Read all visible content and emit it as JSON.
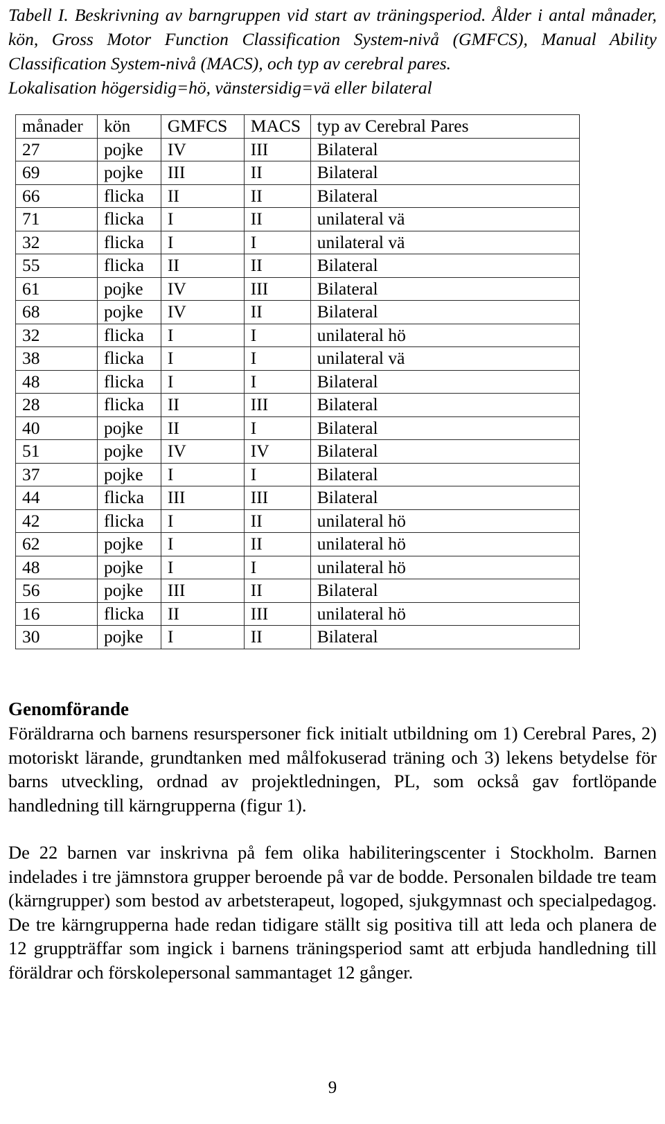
{
  "caption": {
    "lines": [
      "Tabell I. Beskrivning av barngruppen vid start av träningsperiod. Ålder i antal månader, kön, Gross Motor Function Classification System-nivå (GMFCS), Manual Ability Classification System-nivå (MACS), och typ av cerebral pares.",
      "Lokalisation högersidig=hö, vänstersidig=vä eller bilateral"
    ]
  },
  "table": {
    "headers": [
      "månader",
      "kön",
      "GMFCS",
      "MACS",
      "typ av Cerebral Pares"
    ],
    "rows": [
      [
        "27",
        "pojke",
        "IV",
        "III",
        "Bilateral"
      ],
      [
        "69",
        "pojke",
        "III",
        "II",
        "Bilateral"
      ],
      [
        "66",
        "flicka",
        "II",
        "II",
        "Bilateral"
      ],
      [
        "71",
        "flicka",
        "I",
        "II",
        "unilateral vä"
      ],
      [
        "32",
        "flicka",
        "I",
        "I",
        "unilateral vä"
      ],
      [
        "55",
        "flicka",
        "II",
        "II",
        "Bilateral"
      ],
      [
        "61",
        "pojke",
        "IV",
        "III",
        "Bilateral"
      ],
      [
        "68",
        "pojke",
        "IV",
        "II",
        "Bilateral"
      ],
      [
        "32",
        "flicka",
        "I",
        "I",
        "unilateral hö"
      ],
      [
        "38",
        "flicka",
        "I",
        "I",
        "unilateral vä"
      ],
      [
        "48",
        "flicka",
        "I",
        "I",
        "Bilateral"
      ],
      [
        "28",
        "flicka",
        "II",
        "III",
        "Bilateral"
      ],
      [
        "40",
        "pojke",
        "II",
        "I",
        "Bilateral"
      ],
      [
        "51",
        "pojke",
        "IV",
        "IV",
        "Bilateral"
      ],
      [
        "37",
        "pojke",
        "I",
        "I",
        "Bilateral"
      ],
      [
        "44",
        "flicka",
        "III",
        "III",
        "Bilateral"
      ],
      [
        "42",
        "flicka",
        "I",
        "II",
        "unilateral hö"
      ],
      [
        "62",
        "pojke",
        "I",
        "II",
        "unilateral hö"
      ],
      [
        "48",
        "pojke",
        "I",
        "I",
        "unilateral hö"
      ],
      [
        "56",
        "pojke",
        "III",
        "II",
        "Bilateral"
      ],
      [
        "16",
        "flicka",
        "II",
        "III",
        "unilateral hö"
      ],
      [
        "30",
        "pojke",
        "I",
        "II",
        "Bilateral"
      ]
    ]
  },
  "body": {
    "heading": "Genomförande",
    "paragraph_1": "Föräldrarna och barnens resurspersoner fick initialt utbildning om 1) Cerebral Pares, 2) motoriskt lärande, grundtanken med målfokuserad träning och 3) lekens betydelse för barns utveckling, ordnad av projektledningen, PL, som också gav fortlöpande handledning till kärngrupperna (figur 1).",
    "paragraph_2": "De 22 barnen var inskrivna på fem olika habiliteringscenter i Stockholm. Barnen indelades i tre jämnstora grupper beroende på var de bodde. Personalen bildade tre team (kärngrupper) som bestod av arbetsterapeut, logoped, sjukgymnast och specialpedagog. De tre kärngrupperna hade redan tidigare ställt sig positiva till att leda och planera de 12 gruppträffar som ingick i barnens träningsperiod samt att erbjuda handledning till föräldrar och förskolepersonal sammantaget 12 gånger."
  },
  "footer": {
    "page_number": "9"
  }
}
